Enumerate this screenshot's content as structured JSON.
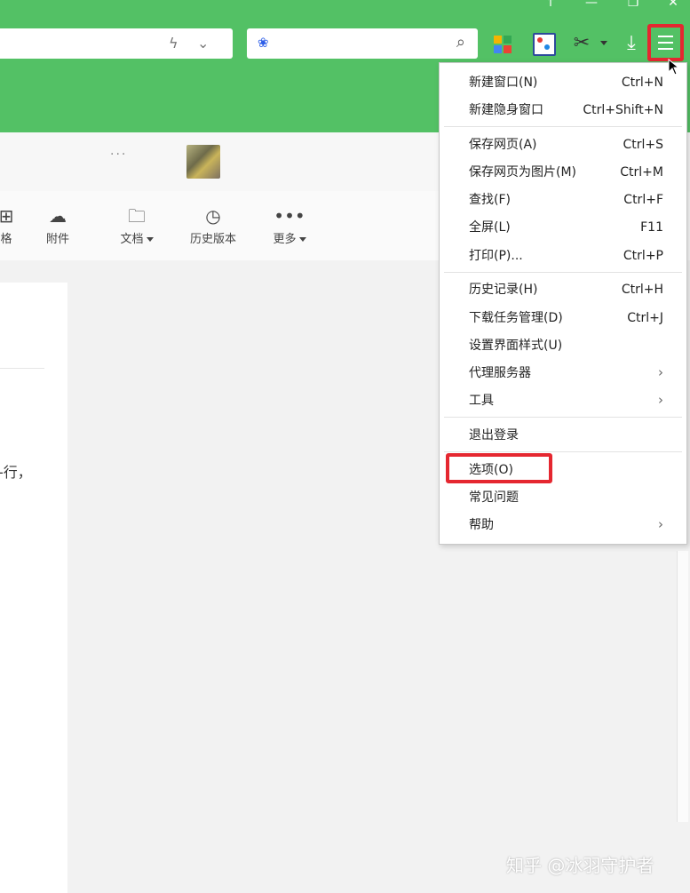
{
  "browser": {
    "window_controls": [
      "↑",
      "—",
      "❐",
      "✕"
    ],
    "address_icons": [
      "lightning-icon",
      "chevron-down-icon"
    ],
    "search_icons": [
      "baidu-paw-icon",
      "search-icon"
    ]
  },
  "document": {
    "tab_more": "···",
    "toolbar": [
      {
        "label": "格",
        "icon": "table-icon"
      },
      {
        "label": "附件",
        "icon": "cloud-icon"
      },
      {
        "label": "文档",
        "icon": "folder-add-icon"
      },
      {
        "label": "历史版本",
        "icon": "clock-icon"
      },
      {
        "label": "更多",
        "icon": "more-icon"
      }
    ],
    "body_fragment": "-行，"
  },
  "menu": {
    "items": [
      {
        "label": "新建窗口(N)",
        "shortcut": "Ctrl+N"
      },
      {
        "label": "新建隐身窗口",
        "shortcut": "Ctrl+Shift+N"
      },
      {
        "label": "保存网页(A)",
        "shortcut": "Ctrl+S"
      },
      {
        "label": "保存网页为图片(M)",
        "shortcut": "Ctrl+M"
      },
      {
        "label": "查找(F)",
        "shortcut": "Ctrl+F"
      },
      {
        "label": "全屏(L)",
        "shortcut": "F11"
      },
      {
        "label": "打印(P)...",
        "shortcut": "Ctrl+P"
      },
      {
        "label": "历史记录(H)",
        "shortcut": "Ctrl+H"
      },
      {
        "label": "下载任务管理(D)",
        "shortcut": "Ctrl+J"
      },
      {
        "label": "设置界面样式(U)",
        "shortcut": ""
      },
      {
        "label": "代理服务器",
        "shortcut": "",
        "submenu": true
      },
      {
        "label": "工具",
        "shortcut": "",
        "submenu": true
      },
      {
        "label": "退出登录",
        "shortcut": ""
      },
      {
        "label": "选项(O)",
        "shortcut": ""
      },
      {
        "label": "常见问题",
        "shortcut": ""
      },
      {
        "label": "帮助",
        "shortcut": "",
        "submenu": true
      }
    ],
    "submenu_arrow": "›"
  },
  "colors": {
    "titlebar": "#53c165",
    "highlight": "#e52730"
  },
  "watermark": "知乎 @冰羽守护者"
}
